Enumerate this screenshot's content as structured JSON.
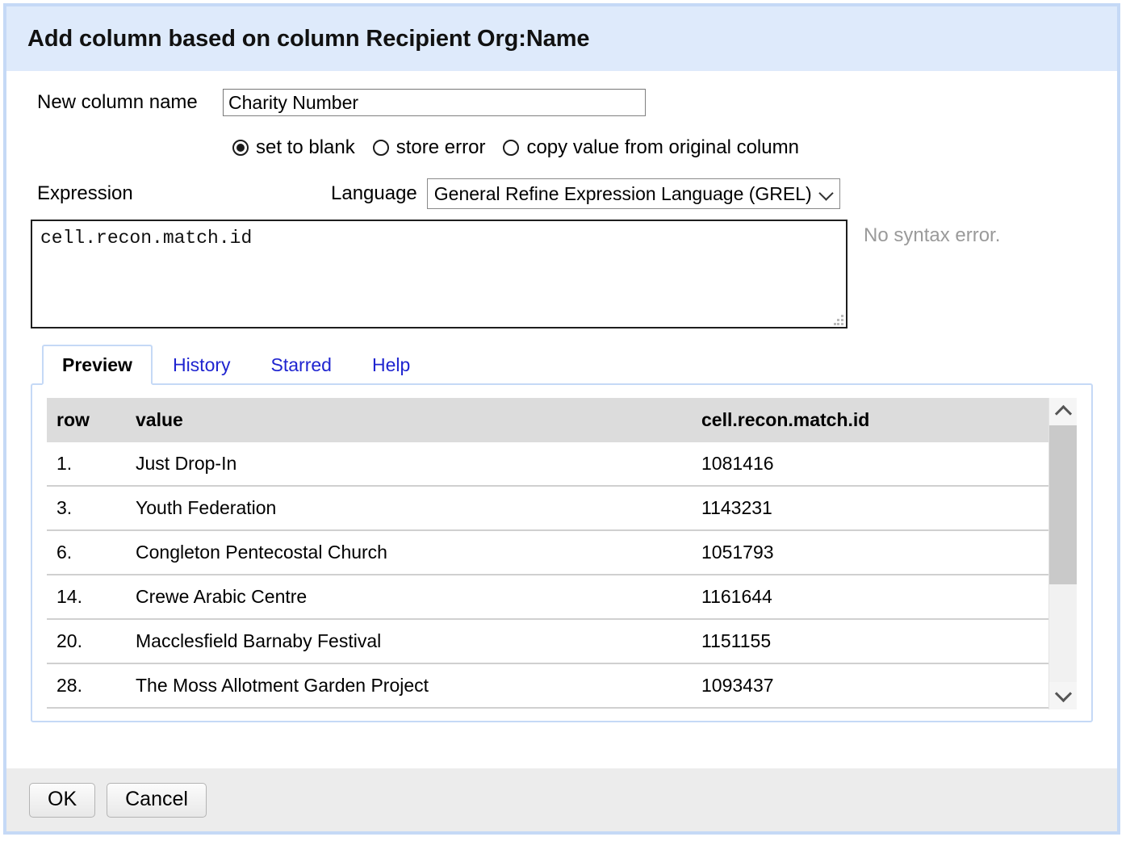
{
  "dialog": {
    "title": "Add column based on column Recipient Org:Name",
    "accent_border": "#c5d9f6",
    "header_bg": "#deeafb",
    "footer_bg": "#ececec"
  },
  "form": {
    "column_name_label": "New column name",
    "column_name_value": "Charity Number",
    "column_name_placeholder": "",
    "on_error": {
      "options": [
        {
          "label": "set to blank",
          "selected": true
        },
        {
          "label": "store error",
          "selected": false
        },
        {
          "label": "copy value from original column",
          "selected": false
        }
      ]
    },
    "expression_label": "Expression",
    "language_label": "Language",
    "language_value": "General Refine Expression Language (GREL)",
    "expression_value": "cell.recon.match.id",
    "status_message": "No syntax error."
  },
  "tabs": [
    {
      "label": "Preview",
      "active": true
    },
    {
      "label": "History",
      "active": false
    },
    {
      "label": "Starred",
      "active": false
    },
    {
      "label": "Help",
      "active": false
    }
  ],
  "preview": {
    "columns": [
      "row",
      "value",
      "cell.recon.match.id"
    ],
    "rows": [
      {
        "row": "1.",
        "value": "Just Drop-In",
        "result": "1081416"
      },
      {
        "row": "3.",
        "value": "Youth Federation",
        "result": "1143231"
      },
      {
        "row": "6.",
        "value": "Congleton Pentecostal Church",
        "result": "1051793"
      },
      {
        "row": "14.",
        "value": "Crewe Arabic Centre",
        "result": "1161644"
      },
      {
        "row": "20.",
        "value": "Macclesfield Barnaby Festival",
        "result": "1151155"
      },
      {
        "row": "28.",
        "value": "The Moss Allotment Garden Project",
        "result": "1093437"
      }
    ],
    "scrollbar": {
      "up_icon": "chevron-up-icon",
      "down_icon": "chevron-down-icon",
      "thumb_fraction": "62%"
    }
  },
  "footer": {
    "ok_label": "OK",
    "cancel_label": "Cancel"
  },
  "icons": {
    "dropdown": "chevron-down-icon",
    "resize": "resize-grip-icon"
  }
}
